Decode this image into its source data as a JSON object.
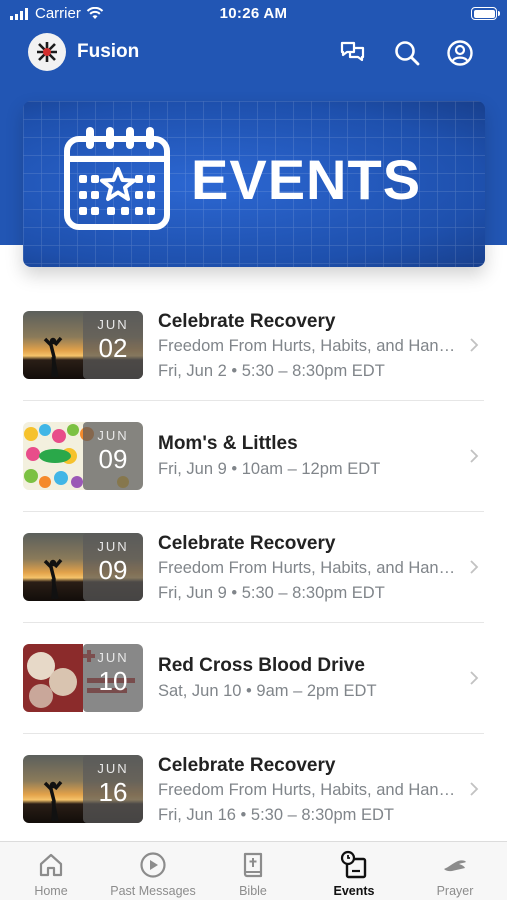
{
  "status_bar": {
    "carrier": "Carrier",
    "time": "10:26 AM"
  },
  "header": {
    "title": "Fusion",
    "icons": [
      "chat-icon",
      "search-icon",
      "profile-icon"
    ]
  },
  "banner": {
    "text": "EVENTS",
    "icon": "calendar-star-icon"
  },
  "events": [
    {
      "title": "Celebrate Recovery",
      "subtitle": "Freedom From Hurts, Habits, and Hang-ups",
      "time": "Fri, Jun 2 • 5:30 – 8:30pm EDT",
      "month": "JUN",
      "day": "02",
      "thumb": "sunset-photo"
    },
    {
      "title": "Mom's & Littles",
      "subtitle": "",
      "time": "Fri, Jun 9 • 10am – 12pm EDT",
      "month": "JUN",
      "day": "09",
      "thumb": "colorful-illustration"
    },
    {
      "title": "Celebrate Recovery",
      "subtitle": "Freedom From Hurts, Habits, and Hang-ups",
      "time": "Fri, Jun 9 • 5:30 – 8:30pm EDT",
      "month": "JUN",
      "day": "09",
      "thumb": "sunset-photo"
    },
    {
      "title": "Red Cross Blood Drive",
      "subtitle": "",
      "time": "Sat, Jun 10 • 9am – 2pm EDT",
      "month": "JUN",
      "day": "10",
      "thumb": "red-cross-flyer"
    },
    {
      "title": "Celebrate Recovery",
      "subtitle": "Freedom From Hurts, Habits, and Hang-ups",
      "time": "Fri, Jun 16 • 5:30 – 8:30pm EDT",
      "month": "JUN",
      "day": "16",
      "thumb": "sunset-photo"
    }
  ],
  "tabs": [
    {
      "label": "Home",
      "icon": "home-icon",
      "active": false
    },
    {
      "label": "Past Messages",
      "icon": "play-circle-icon",
      "active": false
    },
    {
      "label": "Bible",
      "icon": "bible-icon",
      "active": false
    },
    {
      "label": "Events",
      "icon": "events-icon",
      "active": true
    },
    {
      "label": "Prayer",
      "icon": "prayer-icon",
      "active": false
    }
  ],
  "colors": {
    "header_blue": "#2256b4",
    "text_gray": "#80858a",
    "tab_inactive": "#8c8c8c"
  }
}
